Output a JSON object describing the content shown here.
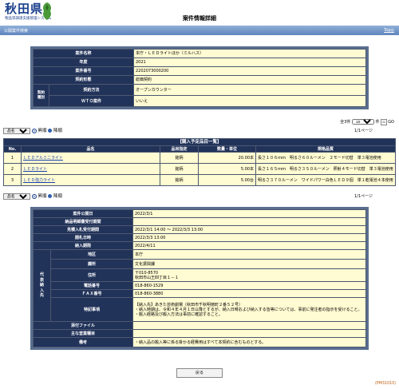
{
  "header": {
    "logo_main": "秋田県",
    "logo_sub": "物品等調達支援管理システム",
    "title": "案件情報詳細",
    "bar_left": "公開案件検索",
    "bar_right": "Top◎"
  },
  "case_info": {
    "rows": [
      {
        "label": "案件名称",
        "value": "本庁・ＬＥＤライトほか（ミルハス）"
      },
      {
        "label": "年度",
        "value": "2021"
      },
      {
        "label": "案件番号",
        "value": "2202073000200"
      },
      {
        "label": "契約形態",
        "value": "総価契約"
      }
    ],
    "contract_label": "契約種別",
    "method_label": "契約方法",
    "method_value": "オープンカウンター",
    "wto_label": "ＷＴＯ案件",
    "wto_value": "いいえ"
  },
  "list_controls": {
    "sort_value": "品名",
    "asc_label": "昇順",
    "desc_label": "降順",
    "total_prefix": "全3件",
    "per_page_value": "10",
    "per_page_suffix": "件",
    "go_label": "GO",
    "page_info": "1/1ページ"
  },
  "item_table": {
    "title": "【購入予定品目一覧】",
    "headers": [
      "No.",
      "品名",
      "品目指定",
      "数量・単位",
      "規格品質"
    ],
    "rows": [
      {
        "no": "1",
        "name": "ＬＥＤアルミニライト",
        "spec": "銘柄",
        "qty": "20.00本",
        "quality": "長さ１０６ｍｍ　明るさ６０ルーメン　２モード切替　単３電池使用"
      },
      {
        "no": "2",
        "name": "ＬＥＤライト",
        "spec": "銘柄",
        "qty": "5.00本",
        "quality": "長さ１６５ｍｍ　明るさ３５０ルーメン　照射４モード切替　単３電池使用"
      },
      {
        "no": "3",
        "name": "ＬＥＤ強力ライト",
        "spec": "銘柄",
        "qty": "5.00台",
        "quality": "明るさ３７０ルーメン　ワイドパワー白色ＬＥＤ９個　単１乾電池４本使用"
      }
    ]
  },
  "detail": {
    "rows_top": [
      {
        "label": "案件公開日",
        "value": "2022/3/1"
      },
      {
        "label": "納品明細書受付期間",
        "value": ""
      },
      {
        "label": "見積入札受付期間",
        "value": "2022/3/1 14:00 ～ 2022/3/3 13:00"
      },
      {
        "label": "開札日時",
        "value": "2022/3/3 13:00"
      },
      {
        "label": "納入期限",
        "value": "2022/4/11"
      }
    ],
    "delivery_label": "代表納入先",
    "delivery_rows": [
      {
        "label": "地区",
        "value": "本庁"
      },
      {
        "label": "課所",
        "value": "文化振興課"
      },
      {
        "label": "住所",
        "value": "〒010-8570",
        "value2": "秋田市山王四丁目１－１"
      },
      {
        "label": "電話番号",
        "value": "018-860-1529"
      },
      {
        "label": "ＦＡＸ番号",
        "value": "018-860-3880"
      },
      {
        "label": "特記事項",
        "value": "【納入先】あきた芸術劇場（秋田市千秋明徳町２番５２号）",
        "value2": "・納入時期は、令和４年４月１日以降とするが、納入日時および納入する皆等については、事前に発注者の指示を受けること。",
        "value3": "・搬入経路及び搬入方法は事前に確認すること。"
      }
    ],
    "rows_bottom": [
      {
        "label": "添付ファイル",
        "value": ""
      },
      {
        "label": "主な営業種目",
        "value": ""
      },
      {
        "label": "備考",
        "value": "・納入品の搬入等に係る掛かる経費用はすべて本契約に含むものとする。"
      }
    ]
  },
  "back_button": "戻る",
  "footer_code": "(PM31010)",
  "colors": {
    "label_bg": "#22335a",
    "value_bg": "#fffbd2",
    "frame": "#5a6e8f",
    "bar": "#6f90c5",
    "brand": "#1a3f8c"
  }
}
